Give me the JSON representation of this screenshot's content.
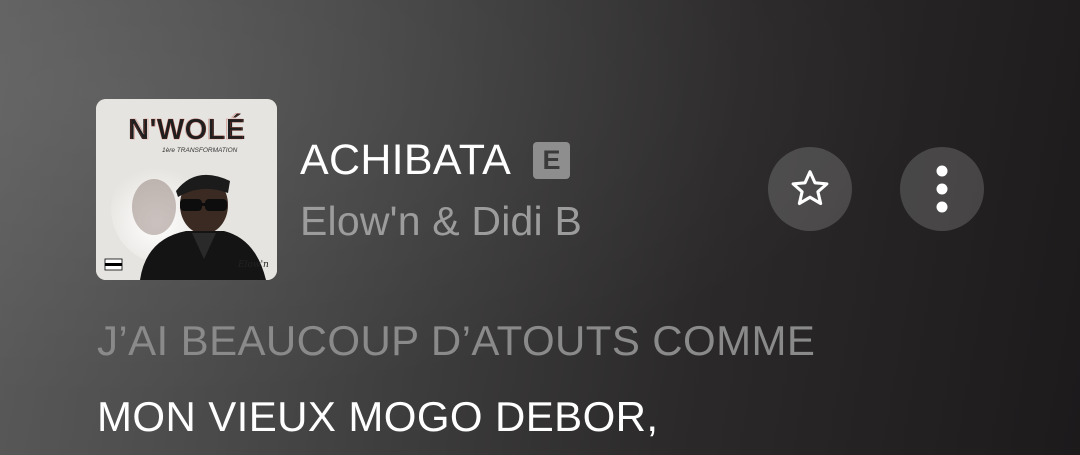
{
  "album": {
    "title_art": "N'WOLÉ",
    "subtitle_art": "1ère TRANSFORMATION",
    "signature_art": "Elow'n",
    "advisory_art": "PARENTAL ADVISORY"
  },
  "track": {
    "title": "ACHIBATA",
    "explicit_badge": "E",
    "artist": "Elow'n & Didi B"
  },
  "actions": {
    "favorite_icon": "star-icon",
    "more_icon": "more-vertical-icon"
  },
  "lyrics": {
    "previous_line": "J’AI BEAUCOUP D’ATOUTS COMME",
    "current_line": "MON VIEUX MOGO DEBOR,"
  },
  "colors": {
    "title": "#ffffff",
    "artist": "#9c9c9c",
    "lyric_past": "#8a8a8a",
    "lyric_current": "#ffffff",
    "explicit_bg": "#8e8e8e",
    "button_bg": "rgba(255,255,255,0.17)"
  }
}
